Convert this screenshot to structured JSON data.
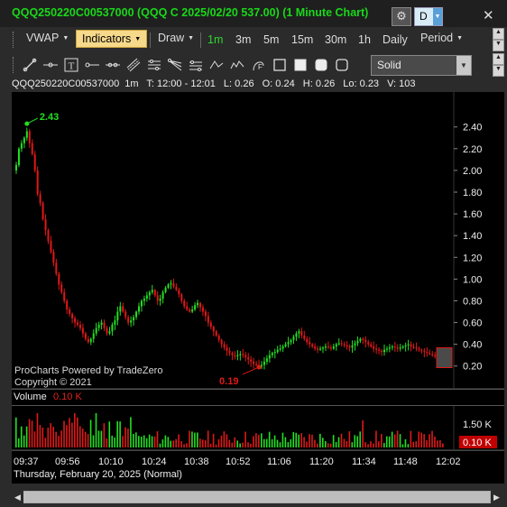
{
  "window": {
    "title": "QQQ250220C00537000 (QQQ C 2025/02/20 537.00) (1 Minute Chart)",
    "settings_icon": "gear-icon",
    "layout_button": "D",
    "close_icon": "close-icon"
  },
  "toolbar": {
    "study": "VWAP",
    "indicators": "Indicators",
    "draw": "Draw",
    "timeframes": [
      "1m",
      "3m",
      "5m",
      "15m",
      "30m",
      "1h",
      "Daily"
    ],
    "selected_timeframe": "1m",
    "period": "Period",
    "line_style": "Solid",
    "draw_tools": [
      "line-tool-icon",
      "horizontal-line-icon",
      "text-tool-icon",
      "ray-icon",
      "extended-line-icon",
      "parallel-channel-icon",
      "fibonacci-retracement-icon",
      "fibonacci-fan-icon",
      "fibonacci-arc-icon",
      "wave-icon",
      "cycle-icon",
      "pitchfork-icon",
      "rectangle-icon",
      "filled-rectangle-icon",
      "rounded-rectangle-icon",
      "ellipse-icon"
    ]
  },
  "info": {
    "symbol": "QQQ250220C00537000",
    "interval": "1m",
    "t": "T: 12:00 - 12:01",
    "l": "L: 0.26",
    "o": "O: 0.24",
    "h": "H: 0.26",
    "lo": "Lo: 0.23",
    "v": "V: 103"
  },
  "watermark": {
    "line1": "ProCharts Powered by TradeZero",
    "line2": "Copyright © 2021"
  },
  "volume": {
    "label": "Volume",
    "last": "0.10 K",
    "axis_label": "1.50 K",
    "badge": "0.10 K"
  },
  "time_axis": {
    "labels": [
      "09:37",
      "09:56",
      "10:10",
      "10:24",
      "10:38",
      "10:52",
      "11:06",
      "11:20",
      "11:34",
      "11:48",
      "12:02"
    ],
    "date": "Thursday, February 20, 2025 (Normal)"
  },
  "colors": {
    "up": "#22e022",
    "down": "#e01818",
    "title": "#19d819",
    "background": "#000000"
  },
  "chart_data": {
    "type": "candlestick",
    "symbol": "QQQ250220C00537000",
    "interval": "1 Minute",
    "y_ticks": [
      "2.40",
      "2.20",
      "2.00",
      "1.80",
      "1.60",
      "1.40",
      "1.20",
      "1.00",
      "0.80",
      "0.60",
      "0.40",
      "0.20"
    ],
    "ylim": [
      0.04,
      2.68
    ],
    "high_marker": {
      "label": "2.43",
      "value": 2.43,
      "time": "09:41"
    },
    "low_marker": {
      "label": "0.19",
      "value": 0.19,
      "time": "11:00"
    },
    "current_price": 0.26,
    "close_series": [
      2.05,
      2.2,
      2.25,
      2.3,
      2.36,
      2.25,
      2.15,
      2.0,
      1.78,
      1.7,
      1.55,
      1.45,
      1.35,
      1.25,
      1.15,
      1.05,
      0.95,
      0.88,
      0.8,
      0.72,
      0.68,
      0.64,
      0.6,
      0.58,
      0.55,
      0.5,
      0.45,
      0.42,
      0.45,
      0.5,
      0.55,
      0.58,
      0.6,
      0.55,
      0.5,
      0.52,
      0.58,
      0.62,
      0.7,
      0.75,
      0.7,
      0.65,
      0.6,
      0.62,
      0.65,
      0.7,
      0.75,
      0.8,
      0.82,
      0.85,
      0.88,
      0.9,
      0.85,
      0.8,
      0.82,
      0.88,
      0.92,
      0.95,
      0.96,
      0.93,
      0.9,
      0.86,
      0.8,
      0.75,
      0.72,
      0.7,
      0.72,
      0.76,
      0.78,
      0.74,
      0.7,
      0.66,
      0.6,
      0.56,
      0.52,
      0.48,
      0.44,
      0.4,
      0.37,
      0.34,
      0.32,
      0.3,
      0.29,
      0.3,
      0.31,
      0.3,
      0.28,
      0.26,
      0.24,
      0.22,
      0.21,
      0.2,
      0.21,
      0.24,
      0.27,
      0.3,
      0.32,
      0.33,
      0.35,
      0.36,
      0.38,
      0.4,
      0.42,
      0.44,
      0.47,
      0.5,
      0.52,
      0.48,
      0.45,
      0.42,
      0.4,
      0.38,
      0.36,
      0.35,
      0.36,
      0.37,
      0.38,
      0.37,
      0.36,
      0.38,
      0.4,
      0.41,
      0.4,
      0.39,
      0.38,
      0.37,
      0.39,
      0.41,
      0.43,
      0.45,
      0.44,
      0.42,
      0.4,
      0.38,
      0.36,
      0.35,
      0.34,
      0.33,
      0.35,
      0.36,
      0.37,
      0.38,
      0.37,
      0.36,
      0.37,
      0.38,
      0.39,
      0.4,
      0.38,
      0.37,
      0.36,
      0.35,
      0.34,
      0.33,
      0.32,
      0.31,
      0.3,
      0.29,
      0.28,
      0.27,
      0.26
    ],
    "volume_axis": "1.50 K"
  }
}
